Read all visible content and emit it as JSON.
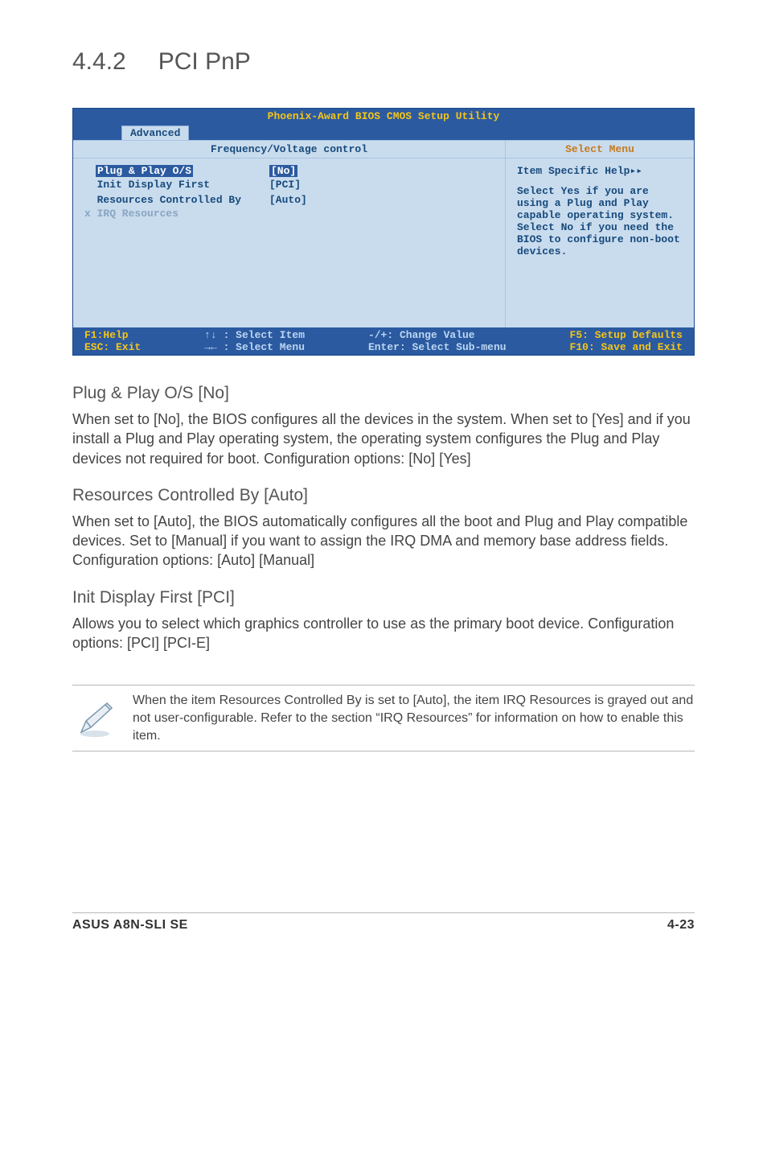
{
  "heading": {
    "num": "4.4.2",
    "title": "PCI PnP"
  },
  "bios": {
    "title": "Phoenix-Award BIOS CMOS Setup Utility",
    "tab": "Advanced",
    "left_header": "Frequency/Voltage control",
    "right_header": "Select Menu",
    "rows": [
      {
        "label": "  Plug & Play O/S",
        "value": "[No]",
        "lstyle": "white",
        "vstyle": "highlight"
      },
      {
        "label": "  Init Display First",
        "value": "[PCI]",
        "lstyle": "blue",
        "vstyle": "blue"
      },
      {
        "label": "",
        "value": ""
      },
      {
        "label": "  Resources Controlled By",
        "value": "[Auto]",
        "lstyle": "blue",
        "vstyle": "blue"
      },
      {
        "label": "x IRQ Resources",
        "value": "",
        "lstyle": "gray"
      }
    ],
    "help_title": "Item Specific Help",
    "help_body": "Select Yes if you are using a Plug and Play capable operating system. Select No if you need the BIOS to configure non-boot devices.",
    "footer": {
      "c1a": "F1:Help",
      "c1b": "ESC: Exit",
      "c2a": "↑↓ : Select Item",
      "c2b": "→← : Select Menu",
      "c3a": "-/+: Change Value",
      "c3b": "Enter: Select Sub-menu",
      "c4a": "F5: Setup Defaults",
      "c4b": "F10: Save and Exit"
    }
  },
  "s1": {
    "h": "Plug & Play O/S [No]",
    "p": "When set to [No], the BIOS configures all the devices in the system. When set to [Yes] and if you install a Plug and Play operating system, the operating system configures the Plug and Play devices not required for boot. Configuration options: [No] [Yes]"
  },
  "s2": {
    "h": "Resources Controlled By [Auto]",
    "p": "When set to [Auto], the BIOS automatically configures all the boot and Plug and Play compatible devices. Set to [Manual] if you want to assign the IRQ DMA and memory base address fields.\nConfiguration options: [Auto] [Manual]"
  },
  "s3": {
    "h": "Init Display First [PCI]",
    "p": "Allows you to select which graphics controller to use as the primary boot device. Configuration options: [PCI] [PCI-E]"
  },
  "note": "When the item Resources Controlled By is set to [Auto], the item IRQ Resources is grayed out and not user-configurable. Refer to the section “IRQ Resources” for information on how to enable this item.",
  "footer": {
    "left": "ASUS A8N-SLI SE",
    "right": "4-23"
  }
}
